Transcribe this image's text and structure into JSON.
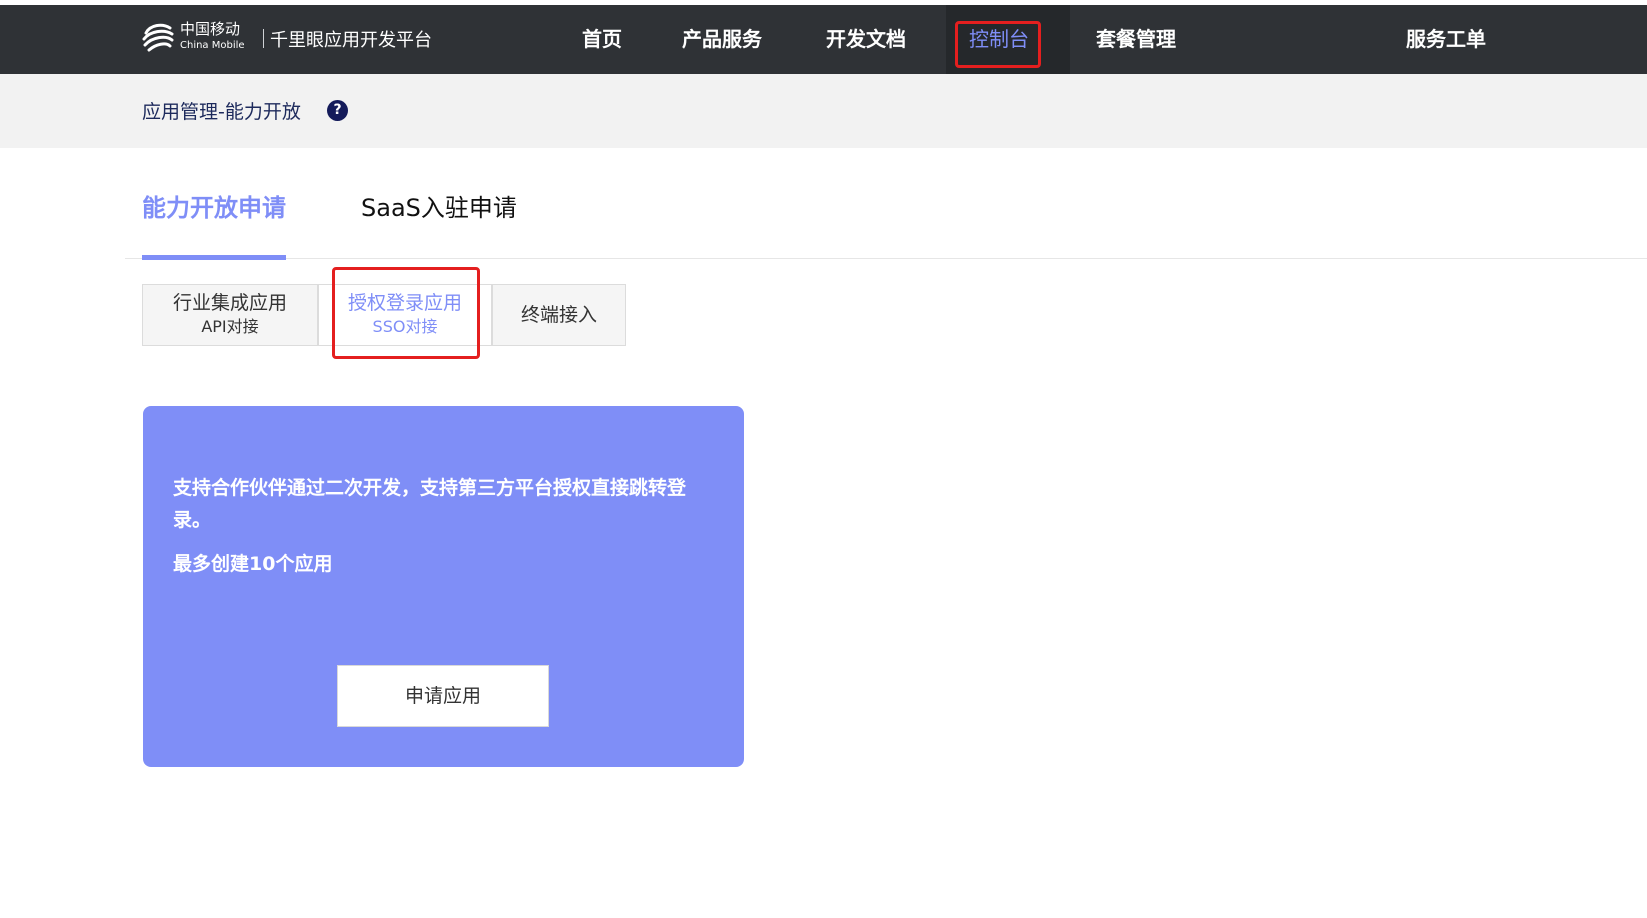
{
  "header": {
    "brand_cn": "中国移动",
    "brand_en": "China Mobile",
    "platform": "千里眼应用开发平台",
    "nav": [
      "首页",
      "产品服务",
      "开发文档",
      "控制台",
      "套餐管理",
      "服务工单"
    ],
    "active_nav": "控制台"
  },
  "breadcrumb": {
    "text": "应用管理-能力开放",
    "help_icon": "?"
  },
  "tabs": [
    {
      "label": "能力开放申请",
      "active": true
    },
    {
      "label": "SaaS入驻申请",
      "active": false
    }
  ],
  "subtabs": [
    {
      "title": "行业集成应用",
      "subtitle": "API对接",
      "active": false
    },
    {
      "title": "授权登录应用",
      "subtitle": "SSO对接",
      "active": true
    },
    {
      "title": "终端接入",
      "subtitle": "",
      "active": false
    }
  ],
  "card": {
    "description": "支持合作伙伴通过二次开发，支持第三方平台授权直接跳转登录。",
    "limit": "最多创建10个应用",
    "button": "申请应用"
  },
  "colors": {
    "accent": "#7f8ef7",
    "nav_bg": "#2f3236",
    "highlight": "#e41f1f"
  },
  "icons": {
    "logo": "china-mobile-logo-icon",
    "help": "question-circle-icon"
  }
}
